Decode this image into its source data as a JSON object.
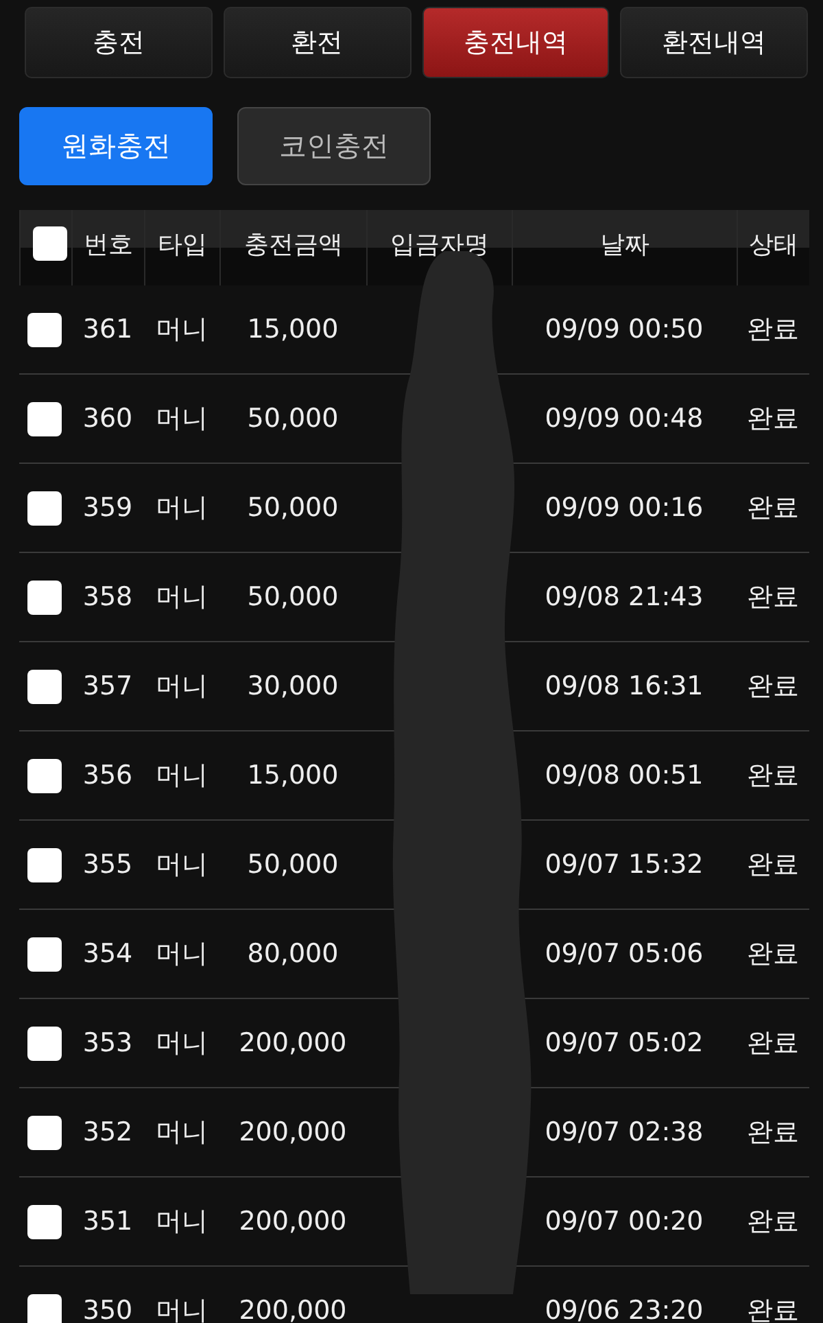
{
  "tabs": [
    {
      "label": "충전",
      "selected": false
    },
    {
      "label": "환전",
      "selected": false
    },
    {
      "label": "충전내역",
      "selected": true
    },
    {
      "label": "환전내역",
      "selected": false
    }
  ],
  "subtabs": [
    {
      "label": "원화충전",
      "selected": true
    },
    {
      "label": "코인충전",
      "selected": false
    }
  ],
  "table": {
    "select_all": {
      "checked": false
    },
    "columns": [
      "번호",
      "타입",
      "충전금액",
      "입금자명",
      "날짜",
      "상태"
    ],
    "rows": [
      {
        "checked": false,
        "no": "361",
        "type": "머니",
        "amount": "15,000",
        "date": "09/09 00:50",
        "status": "완료"
      },
      {
        "checked": false,
        "no": "360",
        "type": "머니",
        "amount": "50,000",
        "date": "09/09 00:48",
        "status": "완료"
      },
      {
        "checked": false,
        "no": "359",
        "type": "머니",
        "amount": "50,000",
        "date": "09/09 00:16",
        "status": "완료"
      },
      {
        "checked": false,
        "no": "358",
        "type": "머니",
        "amount": "50,000",
        "date": "09/08 21:43",
        "status": "완료"
      },
      {
        "checked": false,
        "no": "357",
        "type": "머니",
        "amount": "30,000",
        "date": "09/08 16:31",
        "status": "완료"
      },
      {
        "checked": false,
        "no": "356",
        "type": "머니",
        "amount": "15,000",
        "date": "09/08 00:51",
        "status": "완료"
      },
      {
        "checked": false,
        "no": "355",
        "type": "머니",
        "amount": "50,000",
        "date": "09/07 15:32",
        "status": "완료"
      },
      {
        "checked": false,
        "no": "354",
        "type": "머니",
        "amount": "80,000",
        "date": "09/07 05:06",
        "status": "완료"
      },
      {
        "checked": false,
        "no": "353",
        "type": "머니",
        "amount": "200,000",
        "date": "09/07 05:02",
        "status": "완료"
      },
      {
        "checked": false,
        "no": "352",
        "type": "머니",
        "amount": "200,000",
        "date": "09/07 02:38",
        "status": "완료"
      },
      {
        "checked": false,
        "no": "351",
        "type": "머니",
        "amount": "200,000",
        "date": "09/07 00:20",
        "status": "완료"
      },
      {
        "checked": false,
        "no": "350",
        "type": "머니",
        "amount": "200,000",
        "date": "09/06 23:20",
        "status": "완료"
      }
    ]
  }
}
